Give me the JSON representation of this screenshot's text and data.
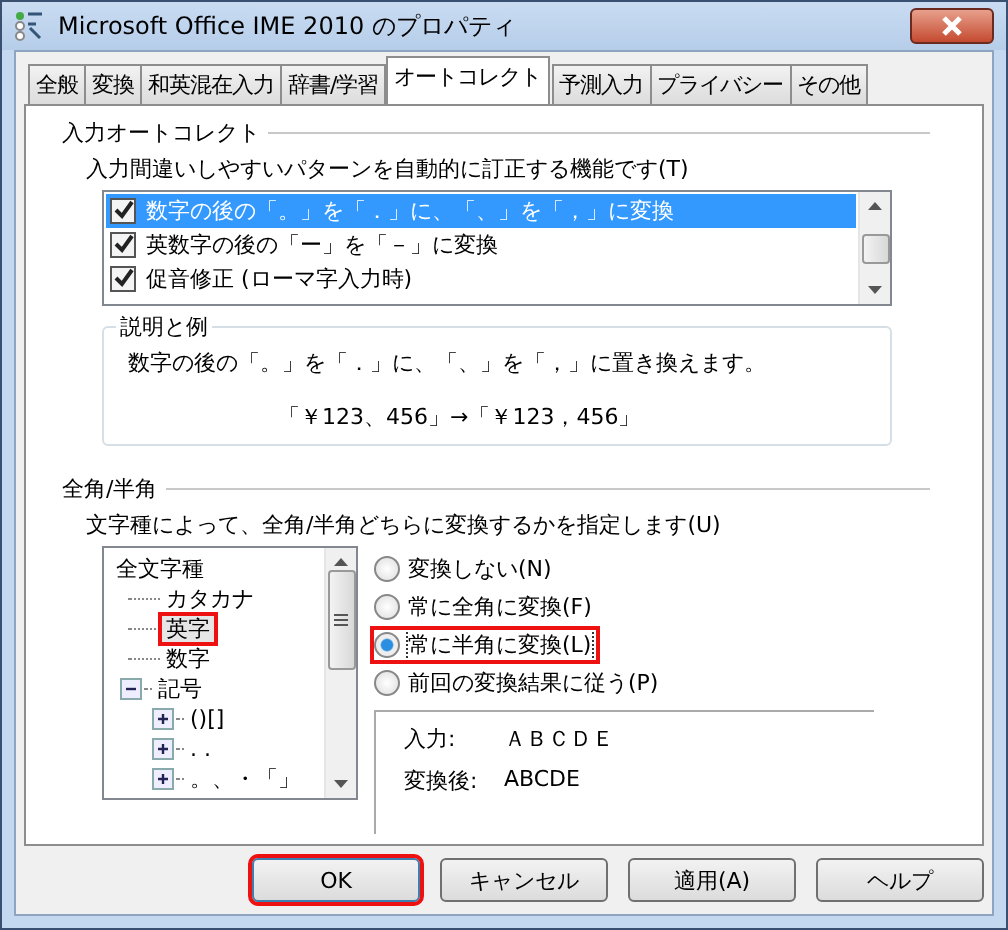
{
  "window": {
    "title": "Microsoft Office IME 2010 のプロパティ"
  },
  "tabs": [
    {
      "label": "全般",
      "selected": false
    },
    {
      "label": "変換",
      "selected": false
    },
    {
      "label": "和英混在入力",
      "selected": false
    },
    {
      "label": "辞書/学習",
      "selected": false
    },
    {
      "label": "オートコレクト",
      "selected": true
    },
    {
      "label": "予測入力",
      "selected": false
    },
    {
      "label": "プライバシー",
      "selected": false
    },
    {
      "label": "その他",
      "selected": false
    }
  ],
  "autocorrect": {
    "title": "入力オートコレクト",
    "description": "入力間違いしやすいパターンを自動的に訂正する機能です(T)",
    "items": [
      {
        "label": "数字の後の「。」を「．」に、「、」を「，」に変換",
        "checked": true,
        "selected": true
      },
      {
        "label": "英数字の後の「ー」を「－」に変換",
        "checked": true,
        "selected": false
      },
      {
        "label": "促音修正 (ローマ字入力時)",
        "checked": true,
        "selected": false
      }
    ],
    "example": {
      "title": "説明と例",
      "text": "数字の後の「。」を「．」に、「、」を「，」に置き換えます。",
      "sample": "「￥123、456」→「￥123，456」"
    }
  },
  "width": {
    "title": "全角/半角",
    "description": "文字種によって、全角/半角どちらに変換するかを指定します(U)",
    "tree": [
      {
        "label": "全文字種",
        "selected": false,
        "highlighted": false,
        "children": [
          {
            "label": "カタカナ",
            "selected": false,
            "highlighted": false
          },
          {
            "label": "英字",
            "selected": true,
            "highlighted": true
          },
          {
            "label": "数字",
            "selected": false,
            "highlighted": false
          },
          {
            "label": "記号",
            "selected": false,
            "highlighted": false,
            "expanded": true,
            "children": [
              {
                "label": "()[]",
                "selected": false,
                "highlighted": false,
                "expanded": false
              },
              {
                "label": ". .",
                "selected": false,
                "highlighted": false,
                "expanded": false
              },
              {
                "label": "。、・「」",
                "selected": false,
                "highlighted": false,
                "expanded": false
              }
            ]
          }
        ]
      }
    ],
    "options": [
      {
        "label": "変換しない(N)",
        "selected": false,
        "highlighted": false
      },
      {
        "label": "常に全角に変換(F)",
        "selected": false,
        "highlighted": false
      },
      {
        "label": "常に半角に変換(L)",
        "selected": true,
        "highlighted": true
      },
      {
        "label": "前回の変換結果に従う(P)",
        "selected": false,
        "highlighted": false
      }
    ],
    "preview": [
      {
        "label": "入力:",
        "value": "ＡＢＣＤＥ"
      },
      {
        "label": "変換後:",
        "value": "ABCDE"
      }
    ]
  },
  "buttons": [
    {
      "label": "OK",
      "highlighted": true
    },
    {
      "label": "キャンセル",
      "highlighted": false
    },
    {
      "label": "適用(A)",
      "highlighted": false
    },
    {
      "label": "ヘルプ",
      "highlighted": false
    }
  ]
}
